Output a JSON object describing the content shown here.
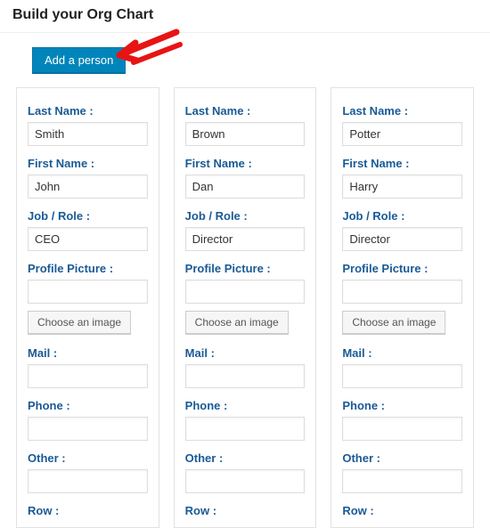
{
  "title": "Build your Org Chart",
  "toolbar": {
    "add_label": "Add a person"
  },
  "labels": {
    "last_name": "Last Name :",
    "first_name": "First Name :",
    "job": "Job / Role :",
    "profile_picture": "Profile Picture :",
    "choose_image": "Choose an image",
    "mail": "Mail :",
    "phone": "Phone :",
    "other": "Other :",
    "row": "Row :"
  },
  "people": [
    {
      "last_name": "Smith",
      "first_name": "John",
      "job": "CEO",
      "profile_picture": "",
      "mail": "",
      "phone": "",
      "other": "",
      "row": ""
    },
    {
      "last_name": "Brown",
      "first_name": "Dan",
      "job": "Director",
      "profile_picture": "",
      "mail": "",
      "phone": "",
      "other": "",
      "row": ""
    },
    {
      "last_name": "Potter",
      "first_name": "Harry",
      "job": "Director",
      "profile_picture": "",
      "mail": "",
      "phone": "",
      "other": "",
      "row": ""
    }
  ]
}
